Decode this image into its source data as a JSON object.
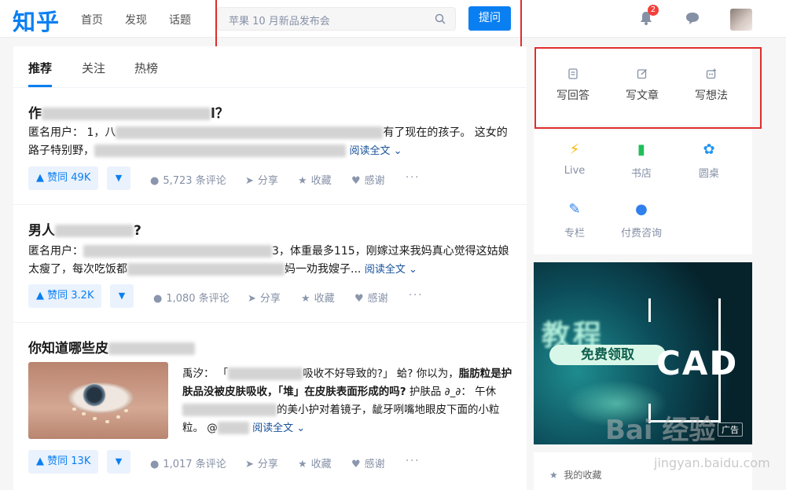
{
  "header": {
    "logo": "知乎",
    "nav": [
      "首页",
      "发现",
      "话题"
    ],
    "search_placeholder": "苹果 10 月新品发布会",
    "ask_label": "提问",
    "notification_count": "2"
  },
  "feed": {
    "tabs": [
      "推荐",
      "关注",
      "热榜"
    ],
    "items": [
      {
        "title_start": "作",
        "title_end": "l？",
        "excerpt_a": "匿名用户：  1，八",
        "excerpt_b": "有了现在的孩子。  这女的路子特别野，",
        "read_more": "阅读全文",
        "vote": "赞同 49K",
        "comments": "5,723 条评论",
        "share": "分享",
        "favorite": "收藏",
        "thanks": "感谢"
      },
      {
        "title_start": "男人",
        "title_end": "?",
        "excerpt_a": "匿名用户：",
        "excerpt_b": "3，体重最多115，刚嫁过来我妈真心觉得这姑娘太瘦了，每次吃饭都",
        "excerpt_c": "妈一劝我嫂子...",
        "read_more": "阅读全文",
        "vote": "赞同 3.2K",
        "comments": "1,080 条评论",
        "share": "分享",
        "favorite": "收藏",
        "thanks": "感谢"
      },
      {
        "title_start": "你知道哪些皮",
        "excerpt_a": "禹汐：  「",
        "excerpt_b": "吸收不好导致的?」  蛤? 你以为，",
        "excerpt_bold": "脂肪粒是护肤品没被皮肤吸收，「堆」在皮肤表面形成的吗?",
        "excerpt_c": "  护肤品 ∂_∂： 午休",
        "excerpt_d": "的美小护对着镜子，龇牙咧嘴地眼皮下面的小粒粒。 @",
        "read_more": "阅读全文",
        "vote": "赞同 13K",
        "comments": "1,017 条评论",
        "share": "分享",
        "favorite": "收藏",
        "thanks": "感谢"
      }
    ]
  },
  "sidebar": {
    "write_actions": [
      "写回答",
      "写文章",
      "写想法"
    ],
    "quick_links": [
      "Live",
      "书店",
      "圆桌",
      "专栏",
      "付费咨询"
    ],
    "ad": {
      "cta": "免费领取",
      "cad": "CAD",
      "tag": "广告",
      "brand_blur": "教程"
    },
    "my_favorites": "我的收藏"
  },
  "watermark": {
    "text": "Bai 经验",
    "url": "jingyan.baidu.com"
  },
  "colors": {
    "brand": "#0a7ff2",
    "highlight_box": "#e02d2d"
  }
}
